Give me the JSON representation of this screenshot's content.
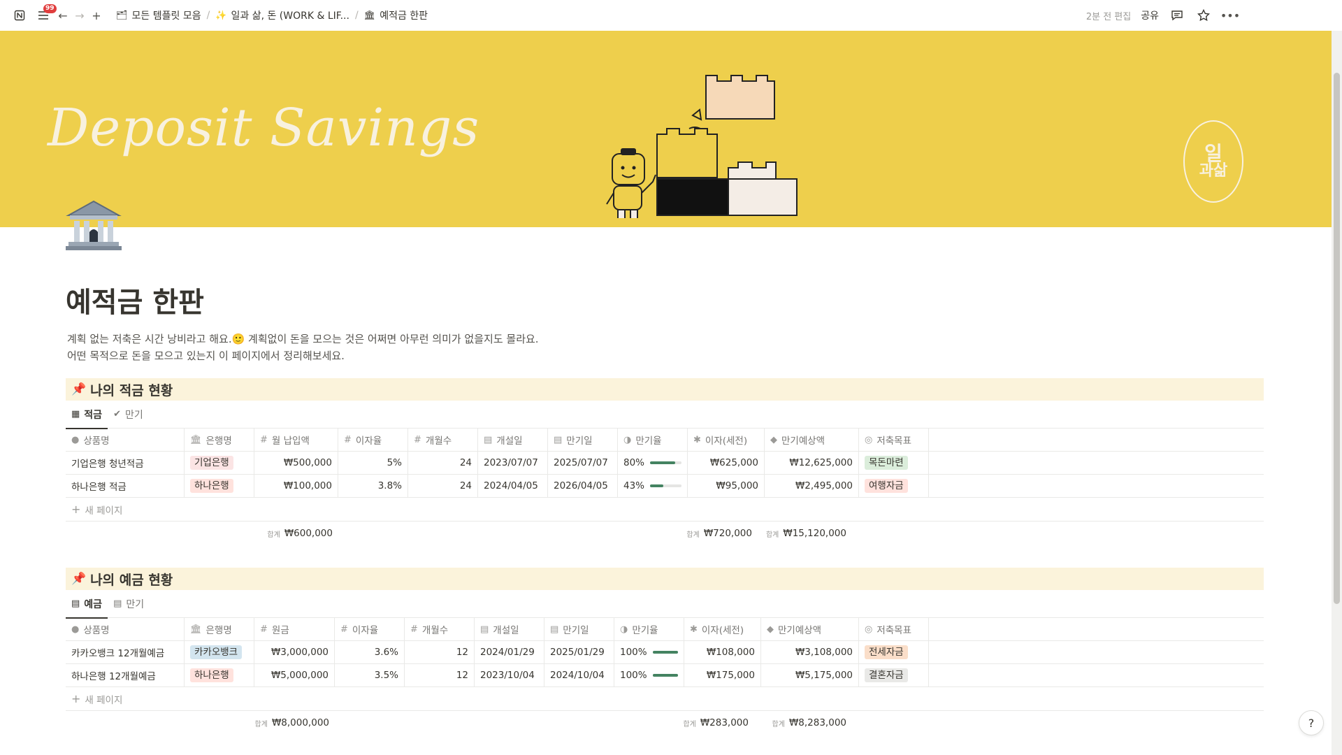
{
  "topbar": {
    "badge": "99",
    "crumbs": [
      {
        "icon": "🗂",
        "label": "모든 템플릿 모음"
      },
      {
        "icon": "✨",
        "label": "일과 삶, 돈 (WORK & LIF..."
      },
      {
        "icon": "🏛",
        "label": "예적금 한판"
      }
    ],
    "edited": "2분 전 편집",
    "share": "공유"
  },
  "cover": {
    "title": "Deposit Savings",
    "logo_top": "일",
    "logo_bottom": "과삶"
  },
  "page": {
    "title": "예적금 한판",
    "desc_line1": "계획 없는 저축은 시간 낭비라고 해요.🙂 계획없이 돈을 모으는 것은 어쩌면 아무런 의미가 없을지도 몰라요.",
    "desc_line2": "어떤 목적으로 돈을 모으고 있는지 이 페이지에서 정리해보세요."
  },
  "savings": {
    "heading": "나의 적금 현황",
    "views": [
      "적금",
      "만기"
    ],
    "headers": [
      "상품명",
      "은행명",
      "월 납입액",
      "이자율",
      "개월수",
      "개설일",
      "만기일",
      "만기율",
      "이자(세전)",
      "만기예상액",
      "저축목표"
    ],
    "rows": [
      {
        "name": "기업은행 청년적금",
        "bank": "기업은행",
        "bank_color": "#fbe4e4",
        "amount": "₩500,000",
        "rate": "5%",
        "months": "24",
        "open": "2023/07/07",
        "maturity": "2025/07/07",
        "progress_label": "80%",
        "progress": 0.8,
        "interest": "₩625,000",
        "expected": "₩12,625,000",
        "goal": "목돈마련",
        "goal_color": "#dbeddb"
      },
      {
        "name": "하나은행 적금",
        "bank": "하나은행",
        "bank_color": "#ffe2dd",
        "amount": "₩100,000",
        "rate": "3.8%",
        "months": "24",
        "open": "2024/04/05",
        "maturity": "2026/04/05",
        "progress_label": "43%",
        "progress": 0.43,
        "interest": "₩95,000",
        "expected": "₩2,495,000",
        "goal": "여행자금",
        "goal_color": "#ffe2dd"
      }
    ],
    "new_page": "새 페이지",
    "sum_label": "합계",
    "sum_amount": "₩600,000",
    "sum_interest": "₩720,000",
    "sum_expected": "₩15,120,000"
  },
  "deposits": {
    "heading": "나의 예금 현황",
    "views": [
      "예금",
      "만기"
    ],
    "headers": [
      "상품명",
      "은행명",
      "원금",
      "이자율",
      "개월수",
      "개설일",
      "만기일",
      "만기율",
      "이자(세전)",
      "만기예상액",
      "저축목표"
    ],
    "rows": [
      {
        "name": "카카오뱅크 12개월예금",
        "bank": "카카오뱅크",
        "bank_color": "#d3e5ef",
        "amount": "₩3,000,000",
        "rate": "3.6%",
        "months": "12",
        "open": "2024/01/29",
        "maturity": "2025/01/29",
        "progress_label": "100%",
        "progress": 1.0,
        "interest": "₩108,000",
        "expected": "₩3,108,000",
        "goal": "전세자금",
        "goal_color": "#fadec9"
      },
      {
        "name": "하나은행 12개월예금",
        "bank": "하나은행",
        "bank_color": "#ffe2dd",
        "amount": "₩5,000,000",
        "rate": "3.5%",
        "months": "12",
        "open": "2023/10/04",
        "maturity": "2024/10/04",
        "progress_label": "100%",
        "progress": 1.0,
        "interest": "₩175,000",
        "expected": "₩5,175,000",
        "goal": "결혼자금",
        "goal_color": "#e9e9e7"
      }
    ],
    "new_page": "새 페이지",
    "sum_label": "합계",
    "sum_amount": "₩8,000,000",
    "sum_interest": "₩283,000",
    "sum_expected": "₩8,283,000"
  }
}
